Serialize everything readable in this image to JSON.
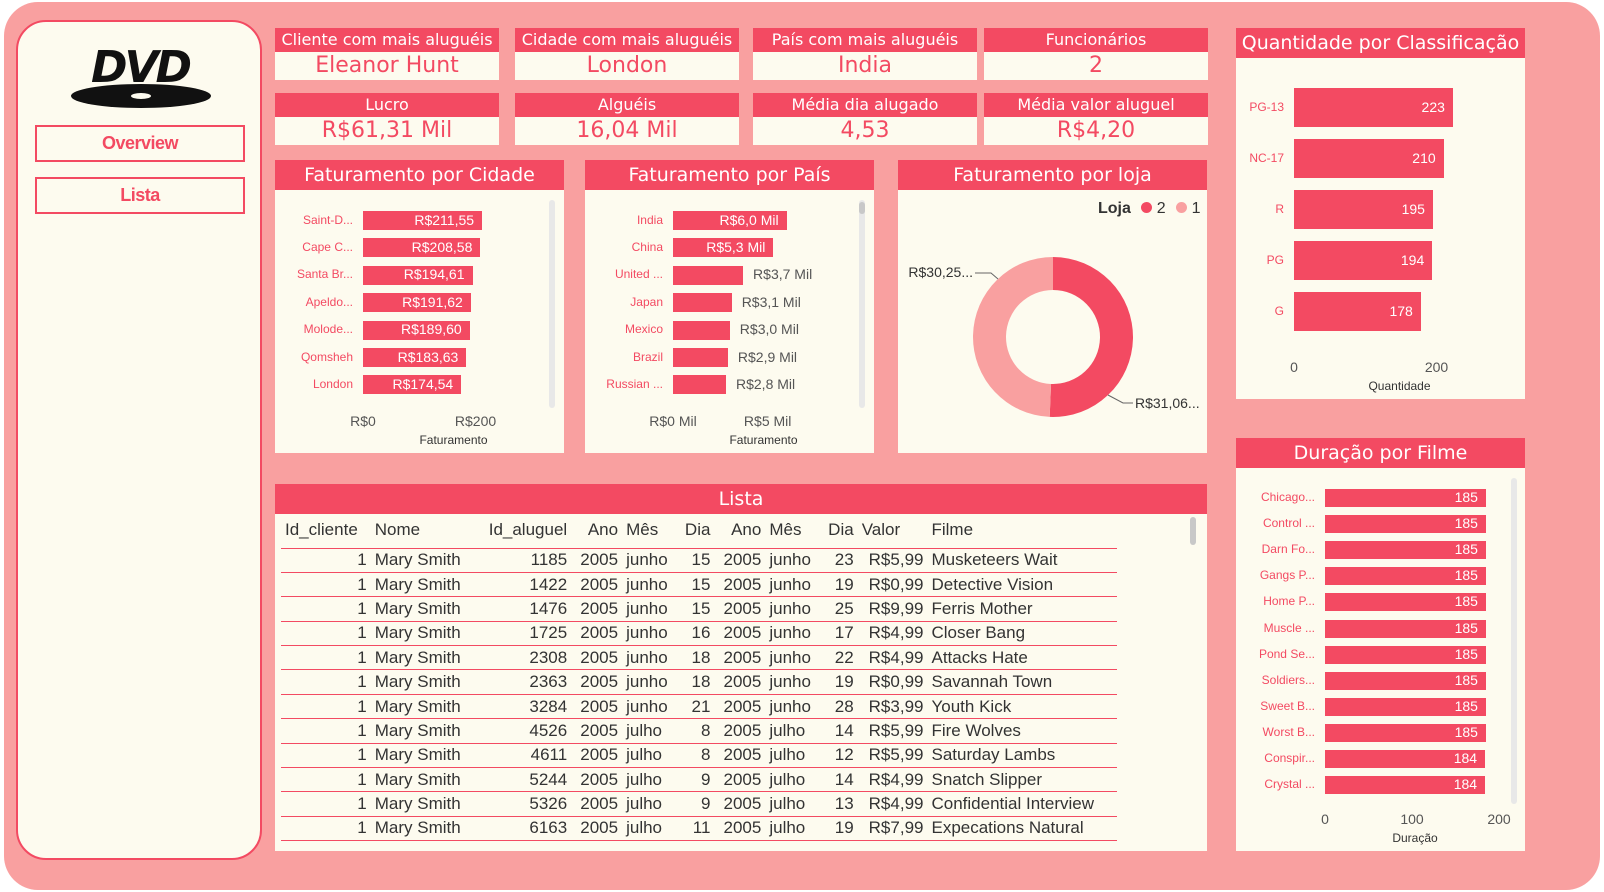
{
  "nav": {
    "logo_text": "DVD",
    "buttons": [
      "Overview",
      "Lista"
    ]
  },
  "kpis": [
    {
      "title": "Cliente com mais aluguéis",
      "value": "Eleanor Hunt"
    },
    {
      "title": "Cidade com mais aluguéis",
      "value": "London"
    },
    {
      "title": "País com mais aluguéis",
      "value": "India"
    },
    {
      "title": "Funcionários",
      "value": "2"
    },
    {
      "title": "Lucro",
      "value": "R$61,31 Mil"
    },
    {
      "title": "Alguéis",
      "value": "16,04 Mil"
    },
    {
      "title": "Média dia alugado",
      "value": "4,53"
    },
    {
      "title": "Média valor aluguel",
      "value": "R$4,20"
    }
  ],
  "colors": {
    "accent": "#f34a62",
    "accent_light": "#f9a0a0",
    "panel": "#fdfbef"
  },
  "chart_data": [
    {
      "type": "bar",
      "orientation": "horizontal",
      "title": "Faturamento por Cidade",
      "categories": [
        "Saint-D...",
        "Cape C...",
        "Santa Br...",
        "Apeldo...",
        "Molode...",
        "Qomsheh",
        "London"
      ],
      "values": [
        211.55,
        208.58,
        194.61,
        191.62,
        189.6,
        183.63,
        174.54
      ],
      "data_labels": [
        "R$211,55",
        "R$208,58",
        "R$194,61",
        "R$191,62",
        "R$189,60",
        "R$183,63",
        "R$174,54"
      ],
      "xlabel": "Faturamento",
      "xticks": [
        "R$0",
        "R$200"
      ],
      "xlim": [
        0,
        263
      ]
    },
    {
      "type": "bar",
      "orientation": "horizontal",
      "title": "Faturamento por País",
      "categories": [
        "India",
        "China",
        "United ...",
        "Japan",
        "Mexico",
        "Brazil",
        "Russian ..."
      ],
      "values": [
        6.0,
        5.3,
        3.7,
        3.1,
        3.0,
        2.9,
        2.8
      ],
      "data_labels": [
        "R$6,0 Mil",
        "R$5,3 Mil",
        "R$3,7 Mil",
        "R$3,1 Mil",
        "R$3,0 Mil",
        "R$2,9 Mil",
        "R$2,8 Mil"
      ],
      "xlabel": "Faturamento",
      "xticks": [
        "R$0 Mil",
        "R$5 Mil"
      ],
      "xlim": [
        0,
        7.5
      ]
    },
    {
      "type": "pie",
      "donut": true,
      "title": "Faturamento por loja",
      "legend_title": "Loja",
      "legend": [
        "2",
        "1"
      ],
      "values": [
        31.06,
        30.25
      ],
      "data_labels": [
        "R$31,06...",
        "R$30,25..."
      ],
      "colors": [
        "#f34a62",
        "#f9a0a0"
      ]
    },
    {
      "type": "bar",
      "orientation": "horizontal",
      "title": "Quantidade por Classificação",
      "categories": [
        "PG-13",
        "NC-17",
        "R",
        "PG",
        "G"
      ],
      "values": [
        223,
        210,
        195,
        194,
        178
      ],
      "xlabel": "Quantidade",
      "xticks": [
        "0",
        "200"
      ],
      "xlim": [
        0,
        261
      ]
    },
    {
      "type": "bar",
      "orientation": "horizontal",
      "title": "Duração por Filme",
      "categories": [
        "Chicago...",
        "Control ...",
        "Darn Fo...",
        "Gangs P...",
        "Home P...",
        "Muscle ...",
        "Pond Se...",
        "Soldiers...",
        "Sweet B...",
        "Worst B...",
        "Conspir...",
        "Crystal ..."
      ],
      "values": [
        185,
        185,
        185,
        185,
        185,
        185,
        185,
        185,
        185,
        185,
        184,
        184
      ],
      "xlabel": "Duração",
      "xticks": [
        "0",
        "100",
        "200"
      ],
      "xlim": [
        0,
        200
      ]
    }
  ],
  "table": {
    "title": "Lista",
    "columns": [
      "Id_cliente",
      "Nome",
      "Id_aluguel",
      "Ano",
      "Mês",
      "Dia",
      "Ano",
      "Mês",
      "Dia",
      "Valor",
      "Filme"
    ],
    "rows": [
      [
        "1",
        "Mary Smith",
        "1185",
        "2005",
        "junho",
        "15",
        "2005",
        "junho",
        "23",
        "R$5,99",
        "Musketeers Wait"
      ],
      [
        "1",
        "Mary Smith",
        "1422",
        "2005",
        "junho",
        "15",
        "2005",
        "junho",
        "19",
        "R$0,99",
        "Detective Vision"
      ],
      [
        "1",
        "Mary Smith",
        "1476",
        "2005",
        "junho",
        "15",
        "2005",
        "junho",
        "25",
        "R$9,99",
        "Ferris Mother"
      ],
      [
        "1",
        "Mary Smith",
        "1725",
        "2005",
        "junho",
        "16",
        "2005",
        "junho",
        "17",
        "R$4,99",
        "Closer Bang"
      ],
      [
        "1",
        "Mary Smith",
        "2308",
        "2005",
        "junho",
        "18",
        "2005",
        "junho",
        "22",
        "R$4,99",
        "Attacks Hate"
      ],
      [
        "1",
        "Mary Smith",
        "2363",
        "2005",
        "junho",
        "18",
        "2005",
        "junho",
        "19",
        "R$0,99",
        "Savannah Town"
      ],
      [
        "1",
        "Mary Smith",
        "3284",
        "2005",
        "junho",
        "21",
        "2005",
        "junho",
        "28",
        "R$3,99",
        "Youth Kick"
      ],
      [
        "1",
        "Mary Smith",
        "4526",
        "2005",
        "julho",
        "8",
        "2005",
        "julho",
        "14",
        "R$5,99",
        "Fire Wolves"
      ],
      [
        "1",
        "Mary Smith",
        "4611",
        "2005",
        "julho",
        "8",
        "2005",
        "julho",
        "12",
        "R$5,99",
        "Saturday Lambs"
      ],
      [
        "1",
        "Mary Smith",
        "5244",
        "2005",
        "julho",
        "9",
        "2005",
        "julho",
        "14",
        "R$4,99",
        "Snatch Slipper"
      ],
      [
        "1",
        "Mary Smith",
        "5326",
        "2005",
        "julho",
        "9",
        "2005",
        "julho",
        "13",
        "R$4,99",
        "Confidential Interview"
      ],
      [
        "1",
        "Mary Smith",
        "6163",
        "2005",
        "julho",
        "11",
        "2005",
        "julho",
        "19",
        "R$7,99",
        "Expecations Natural"
      ]
    ]
  }
}
